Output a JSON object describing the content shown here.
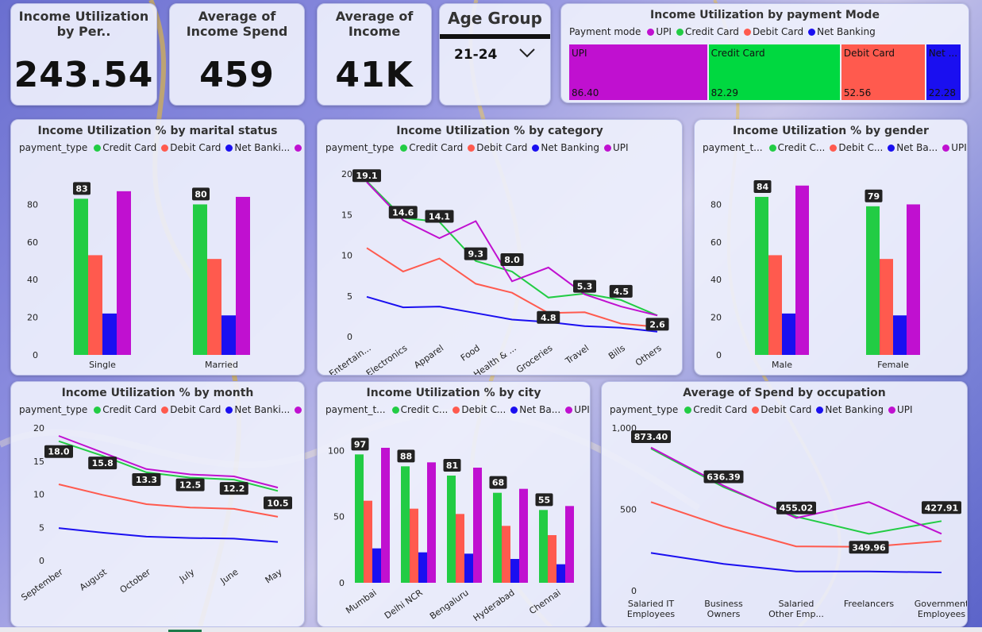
{
  "colors": {
    "credit": "#22cc44",
    "debit": "#ff5a4e",
    "net": "#1a0ff0",
    "upi": "#c010d0"
  },
  "kpis": [
    {
      "title": "Income Utilization by Per..",
      "value": "243.54"
    },
    {
      "title": "Average of Income Spend",
      "value": "459"
    },
    {
      "title": "Average of Income",
      "value": "41K"
    }
  ],
  "slicer": {
    "title": "Age Group",
    "selected": "21-24",
    "icon": "chevron-down-icon"
  },
  "treemap": {
    "title": "Income Utilization by payment Mode",
    "legend_label": "Payment mode",
    "legend": [
      "UPI",
      "Credit Card",
      "Debit Card",
      "Net Banking"
    ],
    "blocks": [
      {
        "label": "UPI",
        "value": 86.4,
        "display": "86.40",
        "color": "#c010d0"
      },
      {
        "label": "Credit Card",
        "value": 82.29,
        "display": "82.29",
        "color": "#00d840"
      },
      {
        "label": "Debit Card",
        "value": 52.56,
        "display": "52.56",
        "color": "#ff5a4e"
      },
      {
        "label": "Net ...",
        "value": 22.28,
        "display": "22.28",
        "color": "#1a0ff0"
      }
    ]
  },
  "marital": {
    "title": "Income Utilization % by marital status",
    "legend_label": "payment_type",
    "legend": [
      "Credit Card",
      "Debit Card",
      "Net Banki...",
      "UPI"
    ],
    "chart_data": {
      "type": "bar",
      "categories": [
        "Single",
        "Married"
      ],
      "series": [
        {
          "name": "Credit Card",
          "values": [
            83,
            80
          ]
        },
        {
          "name": "Debit Card",
          "values": [
            53,
            51
          ]
        },
        {
          "name": "Net Banking",
          "values": [
            22,
            21
          ]
        },
        {
          "name": "UPI",
          "values": [
            87,
            84
          ]
        }
      ],
      "labels": [
        "83",
        "80"
      ],
      "yticks": [
        "0",
        "20",
        "40",
        "60",
        "80"
      ],
      "ylim": [
        0,
        92
      ]
    }
  },
  "category": {
    "title": "Income Utilization % by category",
    "legend_label": "payment_type",
    "legend": [
      "Credit Card",
      "Debit Card",
      "Net Banking",
      "UPI"
    ],
    "chart_data": {
      "type": "line",
      "categories": [
        "Entertain...",
        "Electronics",
        "Apparel",
        "Food",
        "Health & ...",
        "Groceries",
        "Travel",
        "Bills",
        "Others"
      ],
      "series": [
        {
          "name": "Credit Card",
          "values": [
            19.1,
            14.6,
            14.1,
            9.3,
            8.0,
            4.8,
            5.3,
            4.5,
            2.6
          ]
        },
        {
          "name": "Debit Card",
          "values": [
            10.9,
            8.0,
            9.6,
            6.5,
            5.4,
            2.9,
            3.0,
            1.6,
            1.2
          ]
        },
        {
          "name": "Net Banking",
          "values": [
            4.9,
            3.6,
            3.7,
            2.9,
            2.1,
            1.8,
            1.3,
            1.1,
            0.6
          ]
        },
        {
          "name": "UPI",
          "values": [
            19.0,
            14.3,
            12.1,
            14.2,
            6.8,
            8.5,
            5.2,
            3.7,
            2.6
          ]
        }
      ],
      "labels": [
        "19.1",
        "14.6",
        "14.1",
        "9.3",
        "8.0",
        "4.8",
        "5.3",
        "4.5",
        "2.6"
      ],
      "yticks": [
        "0",
        "5",
        "10",
        "15",
        "20"
      ],
      "ylim": [
        0,
        20
      ]
    }
  },
  "gender": {
    "title": "Income Utilization % by gender",
    "legend_label": "payment_t...",
    "legend": [
      "Credit C...",
      "Debit C...",
      "Net Ba...",
      "UPI"
    ],
    "chart_data": {
      "type": "bar",
      "categories": [
        "Male",
        "Female"
      ],
      "series": [
        {
          "name": "Credit Card",
          "values": [
            84,
            79
          ]
        },
        {
          "name": "Debit Card",
          "values": [
            53,
            51
          ]
        },
        {
          "name": "Net Banking",
          "values": [
            22,
            21
          ]
        },
        {
          "name": "UPI",
          "values": [
            90,
            80
          ]
        }
      ],
      "labels": [
        "84",
        "79"
      ],
      "yticks": [
        "0",
        "20",
        "40",
        "60",
        "80"
      ],
      "ylim": [
        0,
        92
      ]
    }
  },
  "month": {
    "title": "Income Utilization % by month",
    "legend_label": "payment_type",
    "legend": [
      "Credit Card",
      "Debit Card",
      "Net Banki...",
      "UPI"
    ],
    "chart_data": {
      "type": "line",
      "categories": [
        "September",
        "August",
        "October",
        "July",
        "June",
        "May"
      ],
      "series": [
        {
          "name": "Credit Card",
          "values": [
            18.0,
            15.8,
            13.3,
            12.5,
            12.2,
            10.5
          ]
        },
        {
          "name": "Debit Card",
          "values": [
            11.5,
            9.9,
            8.5,
            8.0,
            7.8,
            6.6
          ]
        },
        {
          "name": "Net Banking",
          "values": [
            4.9,
            4.2,
            3.6,
            3.4,
            3.3,
            2.8
          ]
        },
        {
          "name": "UPI",
          "values": [
            18.8,
            16.3,
            13.8,
            13.0,
            12.7,
            11.0
          ]
        }
      ],
      "labels": [
        "18.0",
        "15.8",
        "13.3",
        "12.5",
        "12.2",
        "10.5"
      ],
      "yticks": [
        "0",
        "5",
        "10",
        "15",
        "20"
      ],
      "ylim": [
        0,
        20
      ]
    }
  },
  "city": {
    "title": "Income Utilization % by city",
    "legend_label": "payment_t...",
    "legend": [
      "Credit C...",
      "Debit C...",
      "Net Ba...",
      "UPI"
    ],
    "chart_data": {
      "type": "bar",
      "categories": [
        "Mumbai",
        "Delhi NCR",
        "Bengaluru",
        "Hyderabad",
        "Chennai"
      ],
      "series": [
        {
          "name": "Credit Card",
          "values": [
            97,
            88,
            81,
            68,
            55
          ]
        },
        {
          "name": "Debit Card",
          "values": [
            62,
            56,
            52,
            43,
            36
          ]
        },
        {
          "name": "Net Banking",
          "values": [
            26,
            23,
            22,
            18,
            14
          ]
        },
        {
          "name": "UPI",
          "values": [
            102,
            91,
            87,
            71,
            58
          ]
        }
      ],
      "labels": [
        "97",
        "88",
        "81",
        "68",
        "55"
      ],
      "yticks": [
        "0",
        "50",
        "100"
      ],
      "ylim": [
        0,
        108
      ]
    }
  },
  "occupation": {
    "title": "Average of Spend by occupation",
    "legend_label": "payment_type",
    "legend": [
      "Credit Card",
      "Debit Card",
      "Net Banking",
      "UPI"
    ],
    "chart_data": {
      "type": "line",
      "categories": [
        "Salaried IT\nEmployees",
        "Business\nOwners",
        "Salaried\nOther Emp...",
        "Freelancers",
        "Government\nEmployees"
      ],
      "series": [
        {
          "name": "Credit Card",
          "values": [
            873.4,
            636.39,
            455.02,
            349.96,
            427.91
          ]
        },
        {
          "name": "Debit Card",
          "values": [
            545,
            395,
            272,
            270,
            305
          ]
        },
        {
          "name": "Net Banking",
          "values": [
            232,
            165,
            118,
            118,
            112
          ]
        },
        {
          "name": "UPI",
          "values": [
            880,
            645,
            447,
            545,
            350
          ]
        }
      ],
      "labels": [
        "873.40",
        "636.39",
        "455.02",
        "349.96",
        "427.91"
      ],
      "yticks": [
        "0",
        "500",
        "1,000"
      ],
      "ylim": [
        0,
        1000
      ]
    }
  }
}
